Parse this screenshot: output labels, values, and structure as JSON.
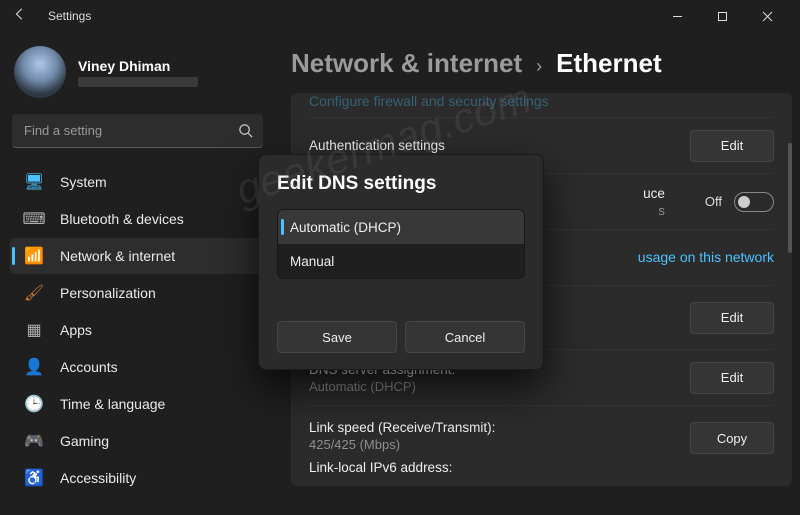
{
  "window": {
    "app_title": "Settings"
  },
  "profile": {
    "name": "Viney Dhiman"
  },
  "search": {
    "placeholder": "Find a setting"
  },
  "sidebar": {
    "items": [
      {
        "label": "System",
        "icon_name": "system-icon",
        "icon_color": "#4cc2ff",
        "glyph": "🖥"
      },
      {
        "label": "Bluetooth & devices",
        "icon_name": "bluetooth-icon",
        "icon_color": "#b0b0b0",
        "glyph": "⌨"
      },
      {
        "label": "Network & internet",
        "icon_name": "wifi-icon",
        "icon_color": "#4cc2ff",
        "glyph": "📶",
        "active": true
      },
      {
        "label": "Personalization",
        "icon_name": "personalization-icon",
        "icon_color": "#d07c2e",
        "glyph": "🖌"
      },
      {
        "label": "Apps",
        "icon_name": "apps-icon",
        "icon_color": "#b0b0b0",
        "glyph": "▦"
      },
      {
        "label": "Accounts",
        "icon_name": "accounts-icon",
        "icon_color": "#3fb37e",
        "glyph": "👤"
      },
      {
        "label": "Time & language",
        "icon_name": "time-language-icon",
        "icon_color": "#5aa0e6",
        "glyph": "🕒"
      },
      {
        "label": "Gaming",
        "icon_name": "gaming-icon",
        "icon_color": "#9aa0a6",
        "glyph": "🎮"
      },
      {
        "label": "Accessibility",
        "icon_name": "accessibility-icon",
        "icon_color": "#6da8ff",
        "glyph": "♿"
      }
    ]
  },
  "breadcrumb": {
    "parent": "Network & internet",
    "current": "Ethernet"
  },
  "main": {
    "truncated_top_link": "Configure firewall and security settings",
    "rows": [
      {
        "key": "auth",
        "label": "Authentication settings",
        "action": "Edit"
      },
      {
        "key": "meter",
        "label_partial": "uce",
        "sub_partial": "s",
        "toggle_label": "Off",
        "toggle_state": "off"
      },
      {
        "key": "datalimit",
        "link_partial": "usage on this network"
      },
      {
        "key": "ip",
        "action": "Edit"
      },
      {
        "key": "dns",
        "label": "DNS server assignment:",
        "sub": "Automatic (DHCP)",
        "action": "Edit"
      },
      {
        "key": "link",
        "label": "Link speed (Receive/Transmit):",
        "sub": "425/425 (Mbps)",
        "action": "Copy",
        "label2": "Link-local IPv6 address:"
      }
    ]
  },
  "dialog": {
    "title": "Edit DNS settings",
    "options": [
      {
        "label": "Automatic (DHCP)",
        "selected": true
      },
      {
        "label": "Manual"
      }
    ],
    "save_label": "Save",
    "cancel_label": "Cancel"
  },
  "watermark": "geekermag.com"
}
